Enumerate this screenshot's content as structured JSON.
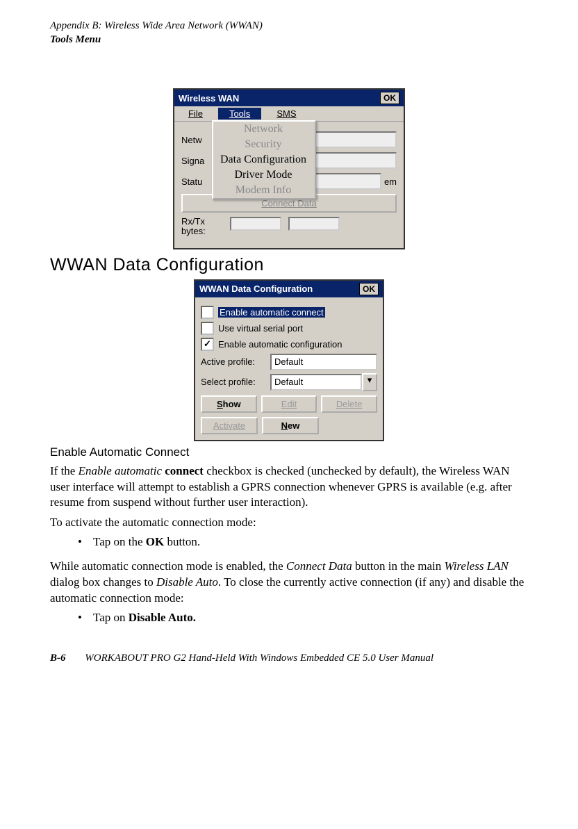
{
  "header": {
    "line1": "Appendix  B:  Wireless Wide Area Network (WWAN)",
    "line2": "Tools Menu"
  },
  "screenshot1": {
    "title": "Wireless WAN",
    "ok": "OK",
    "menu": {
      "file": "File",
      "tools": "Tools",
      "sms": "SMS"
    },
    "dropdown": {
      "network": "Network",
      "security": "Security",
      "dataconfig": "Data Configuration",
      "drivermode": "Driver Mode",
      "modeminfo": "Modem Info"
    },
    "labels": {
      "netw": "Netw",
      "signal": "Signa",
      "status": "Statu",
      "em": "em",
      "rxtx": "Rx/Tx bytes:"
    },
    "connect_btn": "Connect Data"
  },
  "section1_title": "WWAN Data Configuration",
  "screenshot2": {
    "title": "WWAN Data Configuration",
    "ok": "OK",
    "chk1": "Enable automatic connect",
    "chk2": "Use virtual serial port",
    "chk3": "Enable automatic configuration",
    "active_lbl": "Active profile:",
    "select_lbl": "Select profile:",
    "active_val": "Default",
    "select_val": "Default",
    "buttons": {
      "show": "Show",
      "edit": "Edit",
      "delete": "Delete",
      "activate": "Activate",
      "new": "New"
    }
  },
  "subheading": "Enable Automatic Connect",
  "para1_a": "If the ",
  "para1_b": "Enable automatic",
  "para1_c": " connect",
  "para1_d": " checkbox is checked (unchecked by default), the Wireless WAN user interface will attempt to establish a GPRS connection whenever GPRS is available (e.g. after resume from suspend without further user interaction).",
  "para2": "To activate the automatic connection mode:",
  "bullet1_a": "Tap on the ",
  "bullet1_b": "OK",
  "bullet1_c": " button.",
  "para3_a": "While automatic connection mode is enabled, the ",
  "para3_b": "Connect Data",
  "para3_c": " button in the main ",
  "para3_d": "Wireless LAN",
  "para3_e": " dialog box changes to ",
  "para3_f": "Disable Auto",
  "para3_g": ". To close the currently active connection (if any) and disable the automatic connection mode:",
  "bullet2_a": "Tap on ",
  "bullet2_b": "Disable Auto.",
  "footer": {
    "page": "B-6",
    "text": "WORKABOUT PRO G2 Hand-Held With Windows Embedded CE 5.0 User Manual"
  }
}
